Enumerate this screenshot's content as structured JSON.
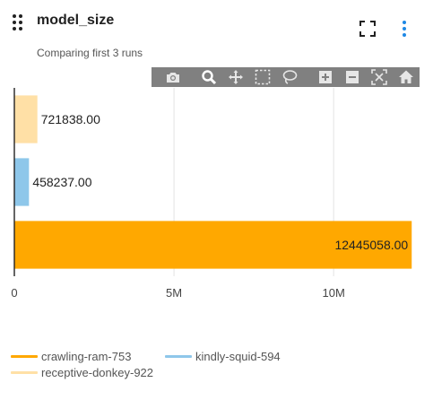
{
  "panel": {
    "title": "model_size",
    "subtitle": "Comparing first 3 runs"
  },
  "modebar": {
    "icons": [
      "camera-icon",
      "zoom-icon",
      "pan-icon",
      "box-select-icon",
      "lasso-select-icon",
      "zoom-in-icon",
      "zoom-out-icon",
      "autoscale-icon",
      "reset-axes-icon"
    ],
    "background": "#808080"
  },
  "chart_data": {
    "type": "bar",
    "orientation": "horizontal",
    "categories": [
      "receptive-donkey-922",
      "kindly-squid-594",
      "crawling-ram-753"
    ],
    "values": [
      721838.0,
      458237.0,
      12445058.0
    ],
    "value_labels": [
      "721838.00",
      "458237.00",
      "12445058.00"
    ],
    "colors": [
      "#ffe0a6",
      "#8ec7ea",
      "#ffa800"
    ],
    "x_ticks": [
      0,
      5000000,
      10000000
    ],
    "x_tick_labels": [
      "0",
      "5M",
      "10M"
    ],
    "xlim": [
      0,
      13000000
    ],
    "grid": true,
    "legend_position": "bottom"
  },
  "legend": {
    "items": [
      {
        "label": "crawling-ram-753",
        "color": "#ffa800"
      },
      {
        "label": "kindly-squid-594",
        "color": "#8ec7ea"
      },
      {
        "label": "receptive-donkey-922",
        "color": "#ffe0a6"
      }
    ]
  }
}
